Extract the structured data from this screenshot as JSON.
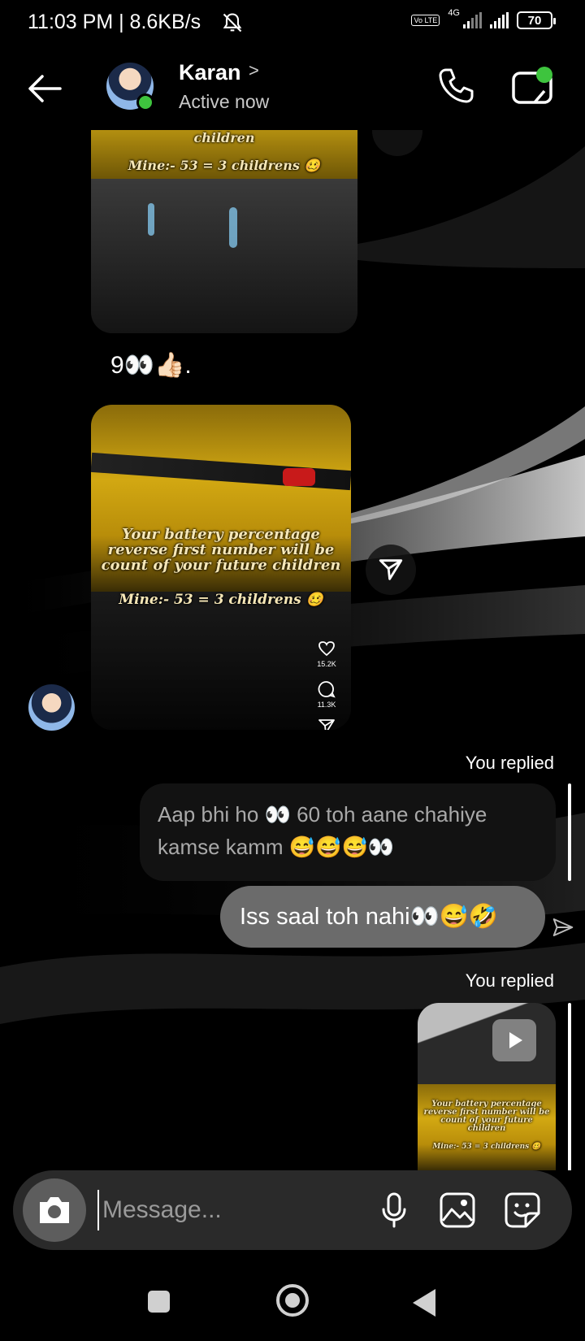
{
  "status_bar": {
    "time_speed": "11:03 PM | 8.6KB/s",
    "network": "4G",
    "volte": "Vo LTE",
    "battery": "70"
  },
  "header": {
    "name": "Karan",
    "chevron": ">",
    "status": "Active now"
  },
  "messages": {
    "reel1_caption_top": "children",
    "reel1_caption_mine": "Mine:- 53 = 3 childrens 🥴",
    "text_message": "9👀👍🏻.",
    "reel2_caption": "Your battery percentage reverse first number will be count of your future children",
    "reel2_caption_mine": "Mine:- 53 = 3 childrens 🥴",
    "reel2_likes": "15.2K",
    "reel2_comments": "11.3K",
    "you_replied_1": "You replied",
    "quoted_reply": "Aap bhi ho 👀 60 toh aane chahiye kamse kamm 😅😅😅👀",
    "my_message": "Iss saal toh nahi👀😅🤣",
    "you_replied_2": "You replied",
    "reel3_caption": "Your battery percentage reverse first number will be count of your future children",
    "reel3_caption_mine": "Mine:- 53 = 3 childrens 🥴"
  },
  "composer": {
    "placeholder": "Message..."
  },
  "icons": {
    "back": "back-arrow-icon",
    "call": "phone-icon",
    "video": "video-call-icon",
    "camera": "camera-icon",
    "mic": "microphone-icon",
    "gallery": "gallery-icon",
    "sticker": "sticker-icon",
    "share": "send-icon"
  }
}
